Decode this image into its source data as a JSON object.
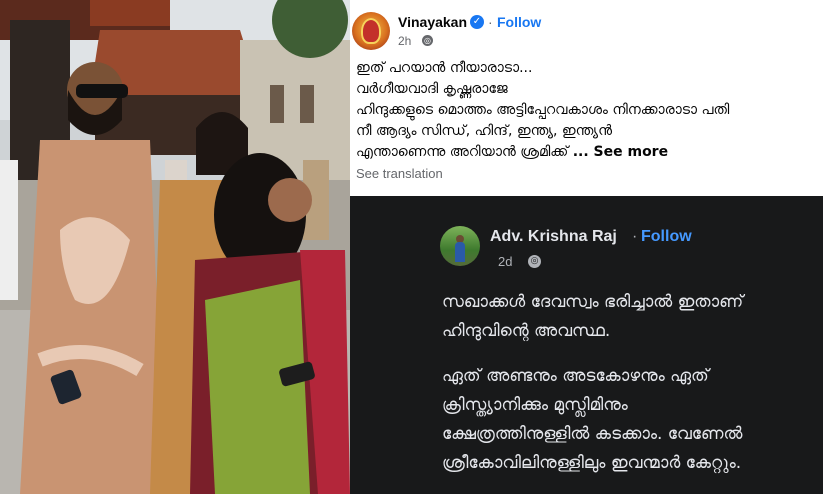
{
  "post_top": {
    "author": "Vinayakan",
    "separator": "·",
    "follow_label": "Follow",
    "time": "2h",
    "lines": [
      "ഇത് പറയാൻ നീയാരാടാ...",
      "വർഗീയവാദി കൃഷ്ണരാജേ",
      "ഹിന്ദുക്കളുടെ മൊത്തം അട്ടിപ്പേറവകാശം നിനക്കാരാടാ പതി",
      "നീ ആദ്യം സിന്ധ്, ഹിന്ദ്,  ഇന്ത്യ, ഇന്ത്യൻ",
      "എന്താണെന്നു അറിയാൻ ശ്രമിക്ക്"
    ],
    "see_more": "... See more",
    "see_translation": "See translation",
    "colors": {
      "name": "#050505",
      "follow": "#1877f2",
      "meta": "#65676b",
      "verified": "#1877f2"
    },
    "icons": [
      "verified-badge-icon",
      "globe-icon"
    ]
  },
  "post_bottom": {
    "author": "Adv. Krishna Raj",
    "separator": "·",
    "follow_label": "Follow",
    "time": "2d",
    "paragraph1": [
      "സഖാക്കൾ ദേവസ്വം ഭരിച്ചാൽ ഇതാണ്",
      "ഹിന്ദുവിന്റെ അവസ്ഥ."
    ],
    "paragraph2": [
      "ഏത് അണ്ടനും അടകോഴനും ഏത്",
      "ക്രിസ്ത്യാനിക്കും മുസ്ലിമിനും",
      "ക്ഷേത്രത്തിനുള്ളിൽ കടക്കാം. വേണേൽ",
      "ശ്രീകോവിലിനുള്ളിലും ഇവന്മാർ കേറ്റും."
    ],
    "colors": {
      "background": "#18191a",
      "text": "#e4e6eb",
      "follow": "#4599ff",
      "meta": "#b0b3b8"
    },
    "icons": [
      "globe-icon"
    ]
  },
  "photo": {
    "icons": [
      "temple-photo"
    ]
  }
}
